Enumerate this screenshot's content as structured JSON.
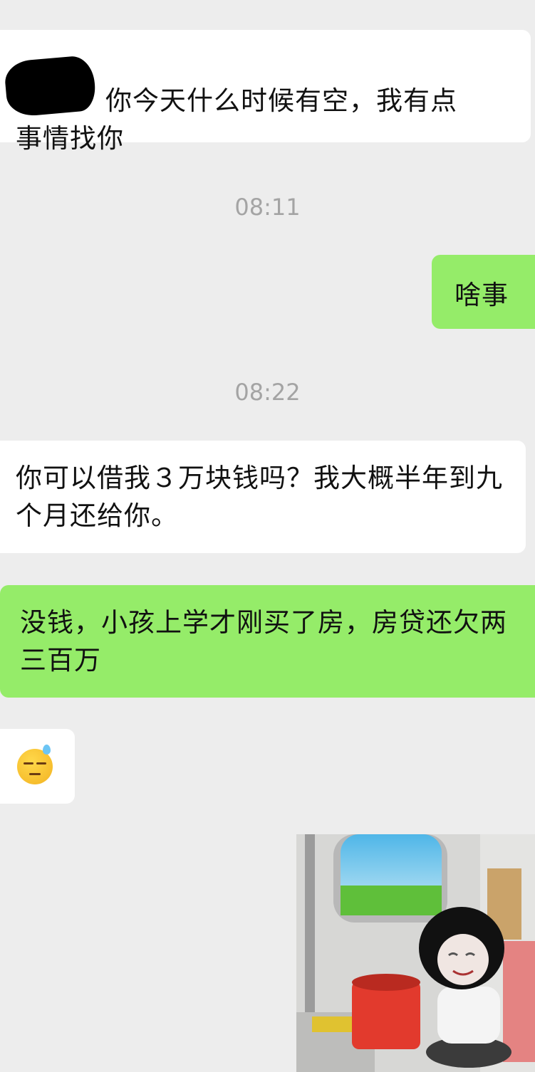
{
  "messages": [
    {
      "id": "msg1",
      "side": "incoming",
      "line1": "你今天什么时候有空，我有点",
      "line2": "事情找你"
    },
    {
      "id": "ts1",
      "type": "timestamp",
      "text": "08:11"
    },
    {
      "id": "msg2",
      "side": "outgoing",
      "text": "啥事"
    },
    {
      "id": "ts2",
      "type": "timestamp",
      "text": "08:22"
    },
    {
      "id": "msg3",
      "side": "incoming",
      "text": "你可以借我３万块钱吗？我大概半年到九个月还给你。"
    },
    {
      "id": "msg4",
      "side": "outgoing",
      "text": "没钱，小孩上学才刚买了房，房贷还欠两三百万"
    },
    {
      "id": "msg5",
      "side": "incoming",
      "emoji": "sweat-expressionless-emoji"
    },
    {
      "id": "sticker",
      "side": "outgoing",
      "image": "meme-sticker-mushroom-head-squatting-on-train"
    }
  ],
  "colors": {
    "background": "#ededed",
    "incoming_bubble": "#ffffff",
    "outgoing_bubble": "#95ec69",
    "timestamp_text": "#a4a4a4"
  }
}
